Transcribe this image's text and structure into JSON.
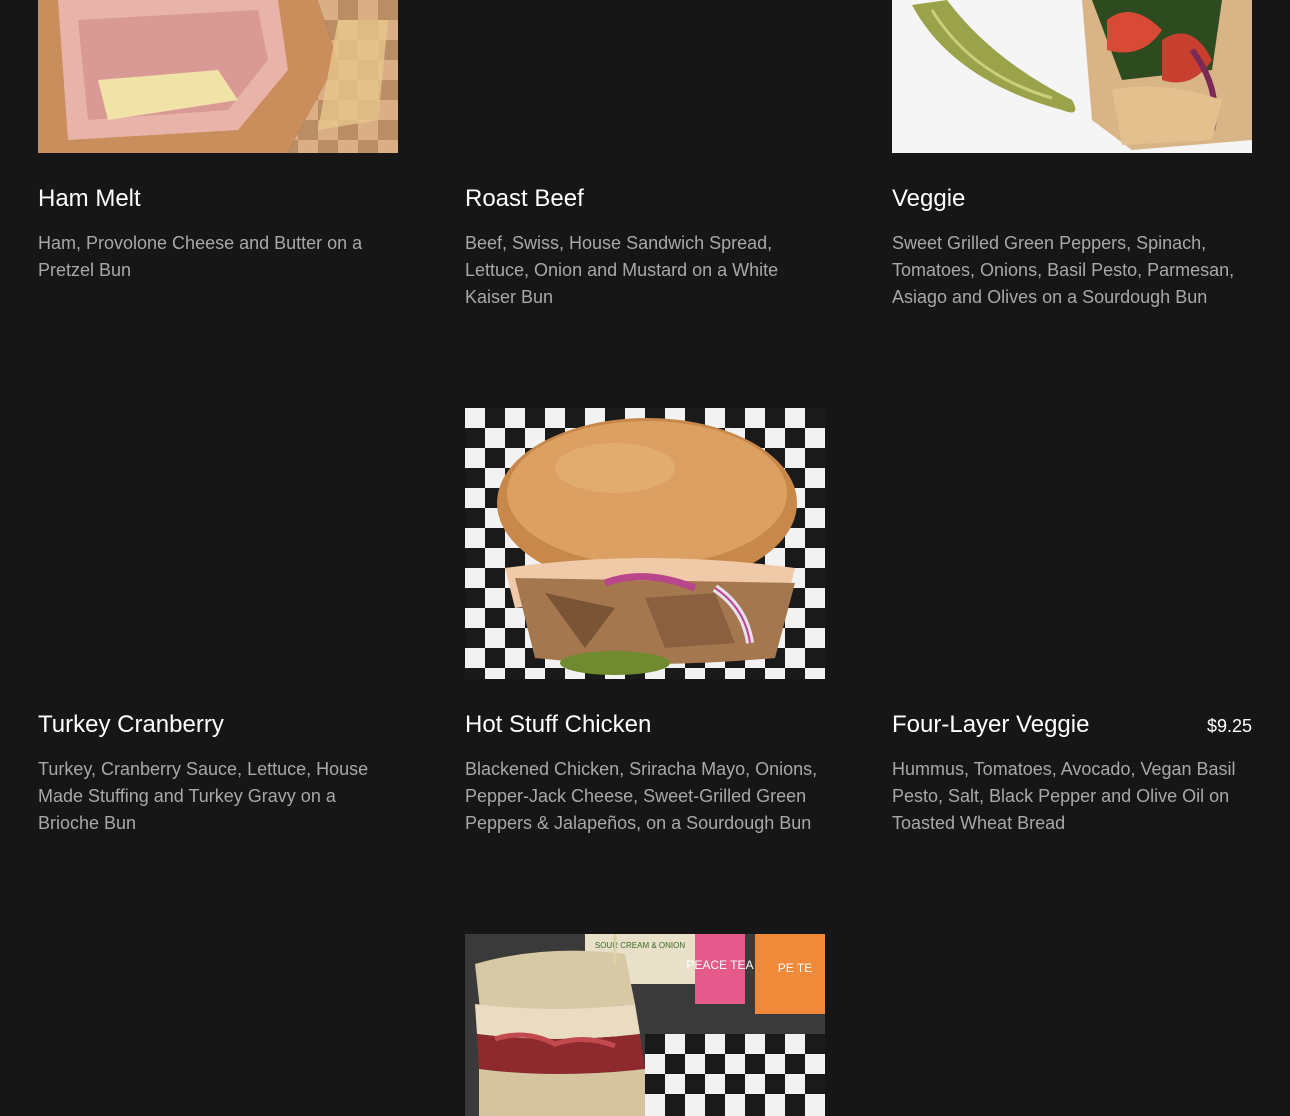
{
  "menu_items": [
    {
      "name": "Ham Melt",
      "description": "Ham, Provolone Cheese and Butter on a Pretzel Bun",
      "price": ""
    },
    {
      "name": "Roast Beef",
      "description": "Beef, Swiss, House Sandwich Spread, Lettuce, Onion and Mustard on a White Kaiser Bun",
      "price": ""
    },
    {
      "name": "Veggie",
      "description": "Sweet Grilled Green Peppers, Spinach, Tomatoes, Onions, Basil Pesto, Parmesan, Asiago and Olives on a Sourdough Bun",
      "price": ""
    },
    {
      "name": "Turkey Cranberry",
      "description": "Turkey, Cranberry Sauce, Lettuce, House Made Stuffing and Turkey Gravy on a Brioche Bun",
      "price": ""
    },
    {
      "name": "Hot Stuff Chicken",
      "description": "Blackened Chicken, Sriracha Mayo, Onions, Pepper-Jack Cheese, Sweet-Grilled Green Peppers & Jalapeños, on a Sourdough Bun",
      "price": ""
    },
    {
      "name": "Four-Layer Veggie",
      "description": "Hummus, Tomatoes, Avocado, Vegan Basil Pesto, Salt, Black Pepper and Olive Oil on Toasted Wheat Bread",
      "price": "$9.25"
    }
  ],
  "photo_labels": {
    "chip_bag": "SOUR CREAM & ONION",
    "tea_bottle": "PEACE TEA",
    "tea_bottle_2": "PE TE"
  },
  "colors": {
    "background": "#161616",
    "title": "#ffffff",
    "description": "#a8a8a8"
  }
}
